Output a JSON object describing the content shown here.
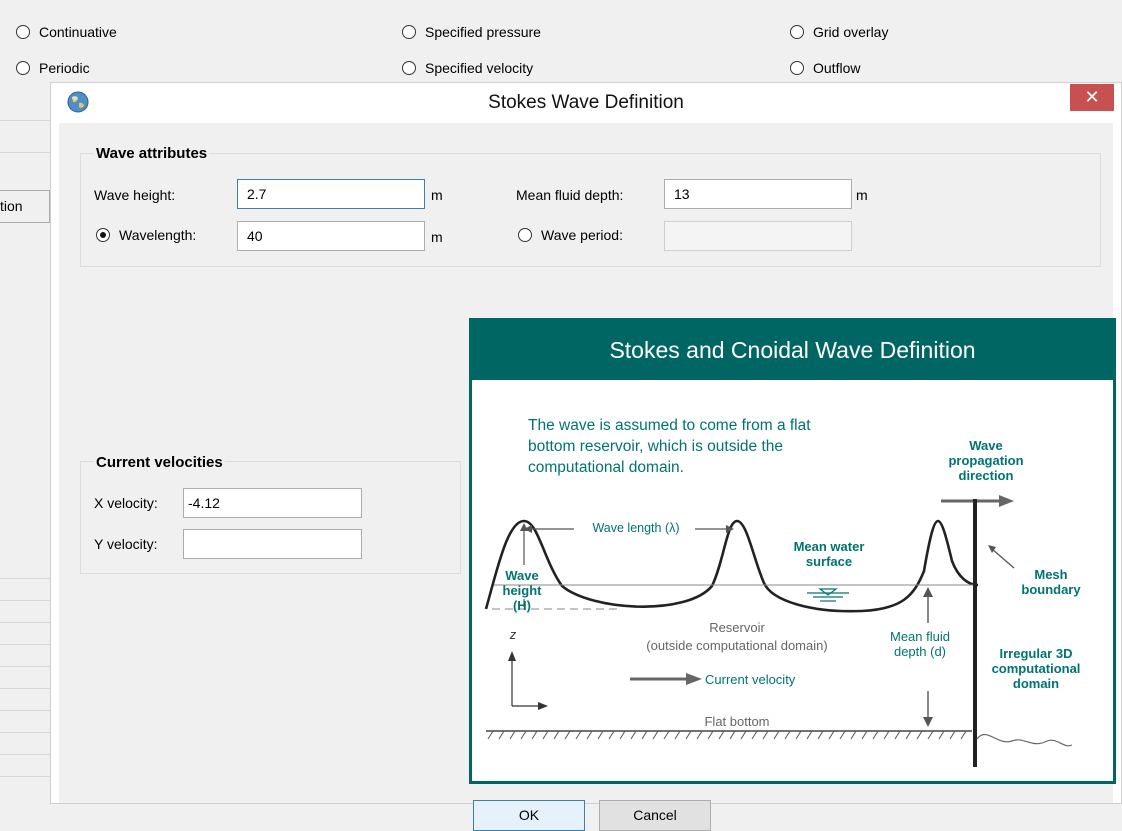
{
  "background": {
    "radios": [
      {
        "label": "Continuative"
      },
      {
        "label": "Specified pressure"
      },
      {
        "label": "Grid overlay"
      },
      {
        "label": "Periodic"
      },
      {
        "label": "Specified velocity"
      },
      {
        "label": "Outflow"
      }
    ],
    "left_tab_label": "tion"
  },
  "dialog": {
    "title": "Stokes Wave Definition",
    "close_label": "✕",
    "wave_attributes": {
      "title": "Wave attributes",
      "wave_height_label": "Wave height:",
      "wave_height_value": "2.7",
      "wave_height_unit": "m",
      "wavelength_label": "Wavelength:",
      "wavelength_value": "40",
      "wavelength_unit": "m",
      "mean_depth_label": "Mean fluid depth:",
      "mean_depth_value": "13",
      "mean_depth_unit": "m",
      "wave_period_label": "Wave period:",
      "wave_period_value": ""
    },
    "current_velocities": {
      "title": "Current velocities",
      "x_label": "X velocity:",
      "x_value": "-4.12",
      "y_label": "Y velocity:",
      "y_value": ""
    },
    "figure": {
      "title": "Stokes and Cnoidal Wave Definition",
      "intro": "The wave is assumed to come from a flat bottom reservoir, which is outside the computational domain.",
      "wave_propagation": "Wave propagation direction",
      "wave_length": "Wave length (λ)",
      "wave_height": "Wave height (H)",
      "mean_water_surface": "Mean water surface",
      "mesh_boundary": "Mesh boundary",
      "reservoir": "Reservoir",
      "reservoir_note": "(outside computational domain)",
      "mean_fluid_depth": "Mean fluid depth (d)",
      "irregular_domain": "Irregular 3D computational domain",
      "current_velocity": "Current velocity",
      "flat_bottom": "Flat bottom",
      "z_axis": "z"
    },
    "ok_label": "OK",
    "cancel_label": "Cancel"
  },
  "colors": {
    "accent": "#006663",
    "close": "#c75050",
    "focus": "#3c7fb1"
  }
}
